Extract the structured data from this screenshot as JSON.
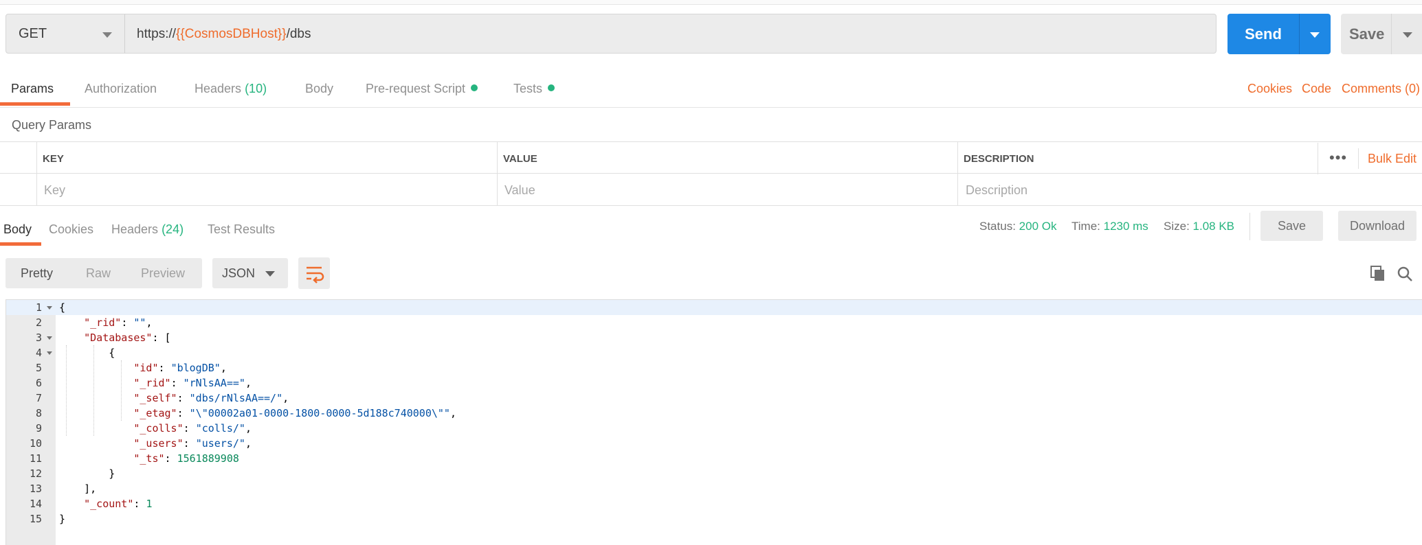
{
  "request": {
    "method": "GET",
    "url_prefix": "https://",
    "url_var": "{{CosmosDBHost}}",
    "url_suffix": "/dbs",
    "send_label": "Send",
    "save_label": "Save"
  },
  "request_tabs": {
    "params": "Params",
    "authorization": "Authorization",
    "headers": "Headers",
    "headers_count": "(10)",
    "body": "Body",
    "prerequest": "Pre-request Script",
    "tests": "Tests",
    "cookies_link": "Cookies",
    "code_link": "Code",
    "comments_link": "Comments (0)"
  },
  "query_params": {
    "title": "Query Params",
    "headers": [
      "KEY",
      "VALUE",
      "DESCRIPTION"
    ],
    "placeholders": [
      "Key",
      "Value",
      "Description"
    ],
    "bulk_edit": "Bulk Edit",
    "more": "•••"
  },
  "response_tabs": {
    "body": "Body",
    "cookies": "Cookies",
    "headers": "Headers",
    "headers_count": "(24)",
    "test_results": "Test Results"
  },
  "response_status": {
    "status_label": "Status:",
    "status_value": "200 Ok",
    "time_label": "Time:",
    "time_value": "1230 ms",
    "size_label": "Size:",
    "size_value": "1.08 KB",
    "save_label": "Save",
    "download_label": "Download"
  },
  "body_view": {
    "pretty": "Pretty",
    "raw": "Raw",
    "preview": "Preview",
    "format": "JSON"
  },
  "response_json": {
    "rid_key": "\"_rid\"",
    "rid_val": "\"\"",
    "databases_key": "\"Databases\"",
    "id_key": "\"id\"",
    "id_val": "\"blogDB\"",
    "rid2_key": "\"_rid\"",
    "rid2_val": "\"rNlsAA==\"",
    "self_key": "\"_self\"",
    "self_val": "\"dbs/rNlsAA==/\"",
    "etag_key": "\"_etag\"",
    "etag_val": "\"\\\"00002a01-0000-1800-0000-5d188c740000\\\"\"",
    "colls_key": "\"_colls\"",
    "colls_val": "\"colls/\"",
    "users_key": "\"_users\"",
    "users_val": "\"users/\"",
    "ts_key": "\"_ts\"",
    "ts_val": "1561889908",
    "count_key": "\"_count\"",
    "count_val": "1"
  },
  "line_numbers": [
    "1",
    "2",
    "3",
    "4",
    "5",
    "6",
    "7",
    "8",
    "9",
    "10",
    "11",
    "12",
    "13",
    "14",
    "15"
  ],
  "colors": {
    "accent": "#f26b3a",
    "send_blue": "#1e88e5",
    "success_green": "#26b47f"
  }
}
